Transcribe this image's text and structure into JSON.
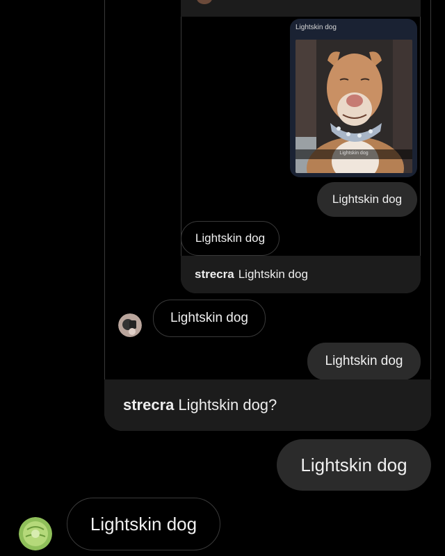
{
  "thread": {
    "outer_reply": {
      "username": "strecra",
      "text": "Lightskin dog?"
    },
    "inner_reply": {
      "username": "strecra",
      "text": "Lightskin dog"
    },
    "shared_post": {
      "header_caption": "Lightskin dog",
      "photo_caption": "Lightskin dog",
      "photo_alt": "Smiling pit bull with studded collar"
    },
    "nested_messages": [
      {
        "sender": "me",
        "text": "Lightskin dog"
      },
      {
        "sender": "them",
        "text": "Lightskin dog"
      },
      {
        "sender": "them",
        "text": "Lightskin dog"
      },
      {
        "sender": "me",
        "text": "Lightskin dog"
      }
    ],
    "messages": [
      {
        "sender": "me",
        "text": "Lightskin dog"
      },
      {
        "sender": "them",
        "text": "Lightskin dog"
      }
    ]
  },
  "colors": {
    "background": "#000000",
    "bubble_outgoing": "#2b2b2b",
    "bubble_incoming_border": "#3a3a3a",
    "quote_bar": "#1c1c1c"
  }
}
